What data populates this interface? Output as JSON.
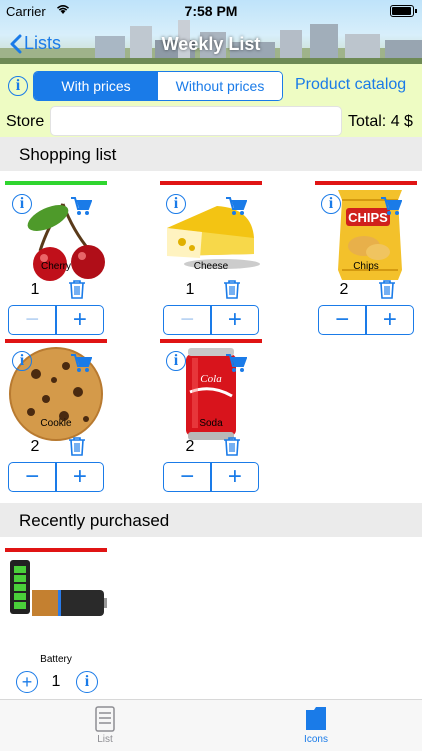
{
  "status": {
    "carrier": "Carrier",
    "time": "7:58 PM"
  },
  "nav": {
    "back_label": "Lists",
    "title": "Weekly List"
  },
  "toolbar": {
    "segments": [
      "With prices",
      "Without prices"
    ],
    "catalog_label": "Product catalog",
    "store_label": "Store",
    "store_value": "",
    "total_label": "Total: 4 $"
  },
  "shopping": {
    "header": "Shopping list",
    "items": [
      {
        "name": "Cherry",
        "qty": "1",
        "status": "green"
      },
      {
        "name": "Cheese",
        "qty": "1",
        "status": "red"
      },
      {
        "name": "Chips",
        "qty": "2",
        "status": "red"
      },
      {
        "name": "Cookie",
        "qty": "2",
        "status": "red"
      },
      {
        "name": "Soda",
        "qty": "2",
        "status": "red"
      }
    ]
  },
  "recent": {
    "header": "Recently purchased",
    "items": [
      {
        "name": "Battery",
        "qty": "1",
        "status": "red"
      }
    ]
  },
  "tabs": [
    {
      "label": "List",
      "icon": "list-icon"
    },
    {
      "label": "Icons",
      "icon": "icons-icon"
    }
  ],
  "colors": {
    "accent": "#1a7be8",
    "green": "#2fd52f",
    "red": "#e01414",
    "toolbar_bg": "#eefcc3"
  }
}
